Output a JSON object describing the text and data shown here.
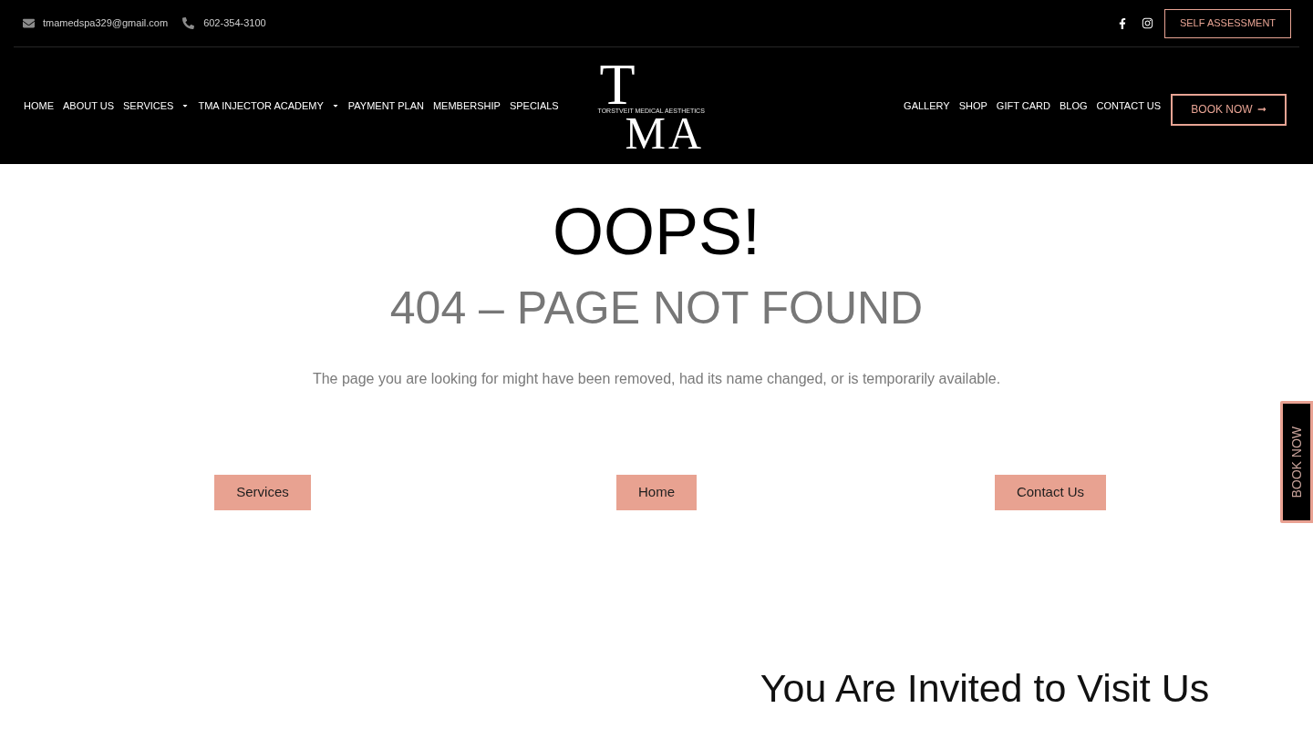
{
  "top_bar": {
    "email": "tmamedspa329@gmail.com",
    "phone": "602-354-3100",
    "cta": "SELF ASSESSMENT"
  },
  "nav": {
    "left_items": [
      {
        "label": "HOME",
        "has_dropdown": false
      },
      {
        "label": "ABOUT US",
        "has_dropdown": false
      },
      {
        "label": "SERVICES",
        "has_dropdown": true
      },
      {
        "label": "TMA INJECTOR ACADEMY",
        "has_dropdown": true
      },
      {
        "label": "PAYMENT PLAN",
        "has_dropdown": false
      },
      {
        "label": "MEMBERSHIP",
        "has_dropdown": false
      },
      {
        "label": "SPECIALS",
        "has_dropdown": false
      }
    ],
    "logo": {
      "letters": [
        "T",
        "M",
        "A"
      ],
      "tagline": "TORSTVEIT MEDICAL AESTHETICS"
    },
    "right_items": [
      {
        "label": "GALLERY",
        "has_dropdown": false
      },
      {
        "label": "SHOP",
        "has_dropdown": false
      },
      {
        "label": "GIFT CARD",
        "has_dropdown": false
      },
      {
        "label": "BLOG",
        "has_dropdown": false
      },
      {
        "label": "CONTACT US",
        "has_dropdown": false
      }
    ],
    "cta": "BOOK NOW"
  },
  "error": {
    "title": "OOPS!",
    "subtitle": "404 – PAGE NOT FOUND",
    "message": "The page you are looking for might have been removed, had its name changed, or is temporarily available."
  },
  "buttons": [
    "Services",
    "Home",
    "Contact Us"
  ],
  "side_tab": "BOOK NOW",
  "section_heading": "You Are Invited to Visit Us"
}
